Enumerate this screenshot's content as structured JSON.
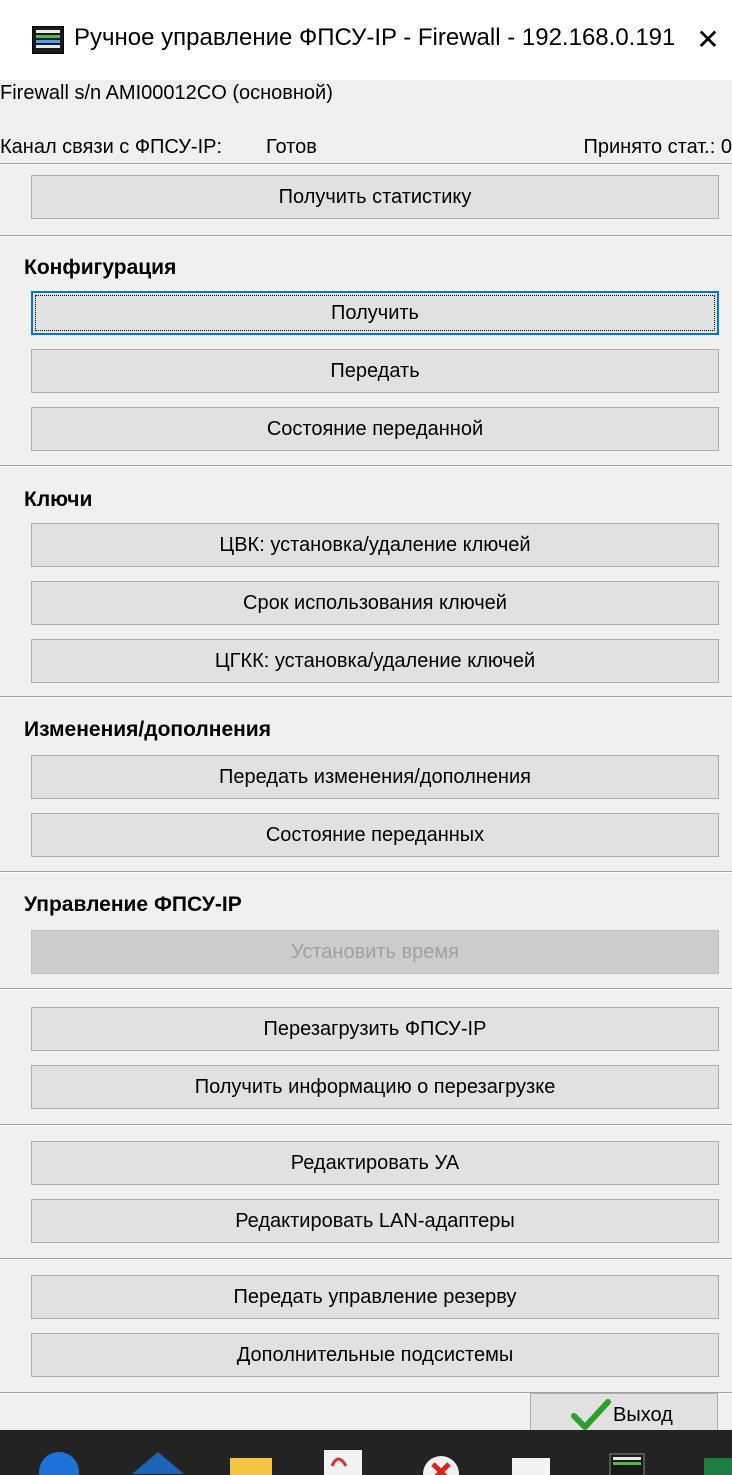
{
  "window": {
    "title": "Ручное управление ФПСУ-IP - Firewall - 192.168.0.191",
    "close_glyph": "✕",
    "subtitle": "Firewall s/n AMI00012CO (основной)"
  },
  "status": {
    "channel_label": "Канал связи с ФПСУ-IP:",
    "channel_value": "Готов",
    "received_label": "Принято стат.: 0"
  },
  "stats": {
    "get_stats": "Получить статистику"
  },
  "config": {
    "heading": "Конфигурация",
    "get": "Получить",
    "send": "Передать",
    "state": "Состояние переданной"
  },
  "keys": {
    "heading": "Ключи",
    "cvk": "ЦВК: установка/удаление ключей",
    "term": "Срок использования ключей",
    "cgkk": "ЦГКК: установка/удаление ключей"
  },
  "changes": {
    "heading": "Изменения/дополнения",
    "send": "Передать изменения/дополнения",
    "state": "Состояние переданных"
  },
  "control": {
    "heading": "Управление ФПСУ-IP",
    "set_time": "Установить время",
    "reboot": "Перезагрузить ФПСУ-IP",
    "reboot_info": "Получить информацию о перезагрузке"
  },
  "edit": {
    "ua": "Редактировать УА",
    "lan": "Редактировать LAN-адаптеры"
  },
  "reserve": {
    "transfer": "Передать управление резерву",
    "subsystems": "Дополнительные подсистемы"
  },
  "footer": {
    "exit": "Выход"
  },
  "icons": {
    "app": "app-icon",
    "close": "close-icon",
    "exit": "check-icon"
  },
  "colors": {
    "focus_border": "#0078d7",
    "button_bg": "#e1e1e1",
    "disabled_text": "#a0a0a0",
    "check_green": "#2e9e2e"
  }
}
